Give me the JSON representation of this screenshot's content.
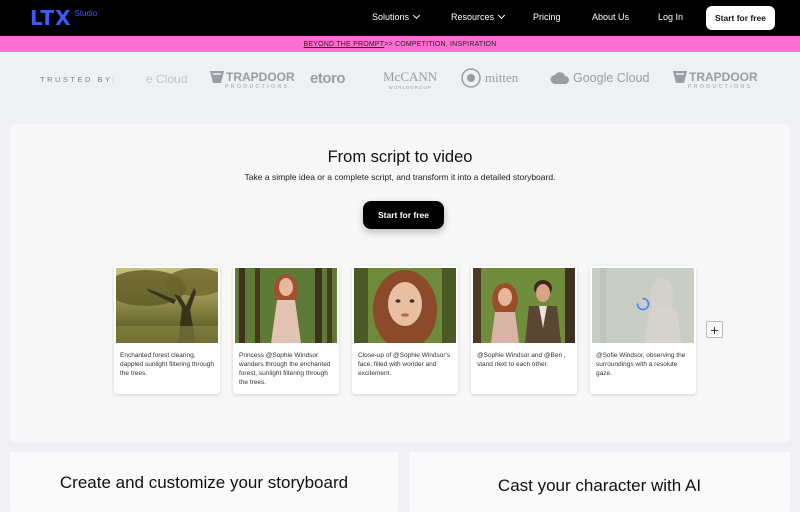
{
  "brand": {
    "ltx": "LTX",
    "studio": "Studio"
  },
  "nav": {
    "solutions": "Solutions",
    "resources": "Resources",
    "pricing": "Pricing",
    "about": "About Us",
    "login": "Log In",
    "cta": "Start for free"
  },
  "banner": {
    "link": "BEYOND THE PROMPT",
    "rest": " >> COMPETITION, INSPIRATION"
  },
  "trusted": {
    "label": "TRUSTED BY:",
    "logos": [
      "e Cloud",
      "TRAPDOOR",
      "PRODUCTIONS",
      "etoro",
      "McCANN",
      "WORLDGROUP",
      "mitten",
      "Google Cloud",
      "TRAPDOOR",
      "PRODUCTIONS"
    ]
  },
  "hero": {
    "title": "From script to video",
    "subtitle": "Take a simple idea or a complete script, and transform it into a detailed storyboard.",
    "cta": "Start for free"
  },
  "cards": [
    {
      "text": "Enchanted forest clearing, dappled sunlight filtering through the trees."
    },
    {
      "text": "Princess @Sophie Windsor wanders through the enchanted forest, sunlight filtering through the trees."
    },
    {
      "text": "Close-up of @Sophie Windsor's face, filled with wonder and excitement."
    },
    {
      "text": "@Sophie Windsor and @Ben , stand next to each other."
    },
    {
      "text": "@Sofie Windsor, observing the surroundings with a resolute gaze."
    }
  ],
  "add_label": "+",
  "sections": {
    "left_title": "Create and customize your storyboard",
    "right_title": "Cast your character with AI"
  },
  "colors": {
    "brand": "#3b5bff",
    "banner": "#ff6ed2"
  }
}
